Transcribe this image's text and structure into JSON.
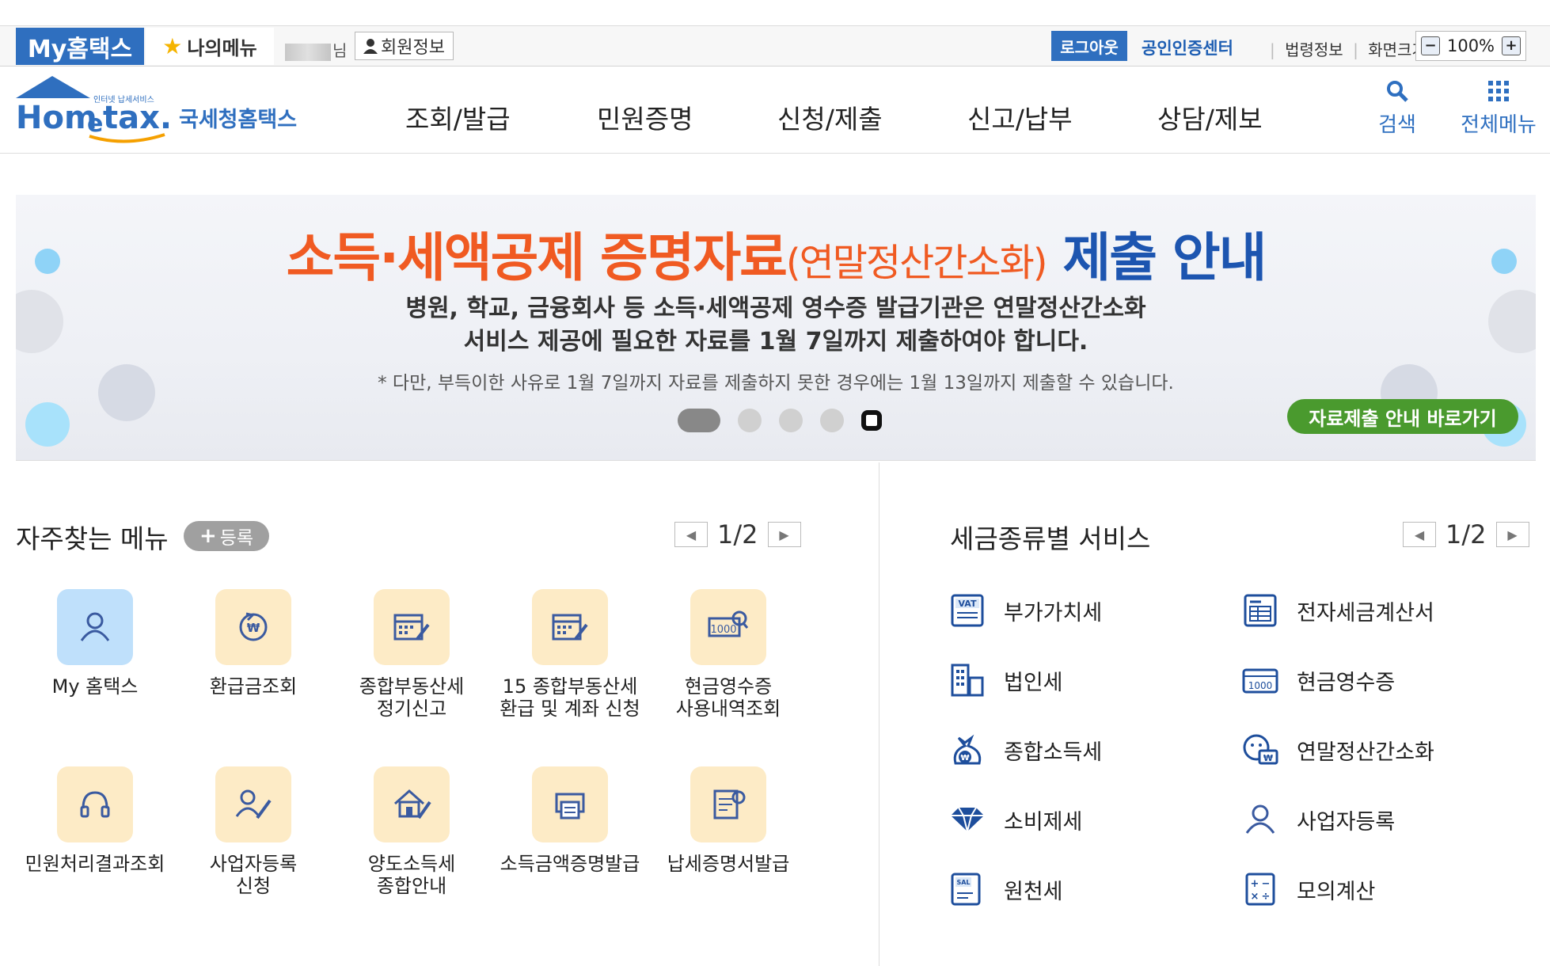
{
  "util": {
    "my_hometax": "My홈택스",
    "my_menu": "나의메뉴",
    "username_suffix": "님",
    "member_info": "회원정보",
    "logout": "로그아웃",
    "cert_center": "공인인증센터",
    "legal_info": "법령정보",
    "screen_size": "화면크기",
    "zoom_level": "100%"
  },
  "header": {
    "logo_small": "인터넷 납세서비스",
    "logo_main": "Hometax",
    "logo_kr": "국세청홈택스",
    "nav": [
      "조회/발급",
      "민원증명",
      "신청/제출",
      "신고/납부",
      "상담/제보"
    ],
    "search_label": "검색",
    "all_menu_label": "전체메뉴"
  },
  "banner": {
    "title_main": "소득·세액공제 증명자료",
    "title_paren": "(연말정산간소화)",
    "title_end": "제출 안내",
    "line1": "병원, 학교, 금융회사 등 소득·세액공제 영수증 발급기관은 연말정산간소화",
    "line2": "서비스 제공에 필요한 자료를 1월 7일까지 제출하여야 합니다.",
    "note": "* 다만, 부득이한 사유로 1월 7일까지 자료를 제출하지 못한 경우에는 1월 13일까지 제출할 수 있습니다.",
    "cta": "자료제출 안내 바로가기",
    "slide_count": 5,
    "active_slide": 1
  },
  "favorites": {
    "title": "자주찾는 메뉴",
    "register": "등록",
    "page": "1/2",
    "items": [
      {
        "line1": "My 홈택스",
        "line2": "",
        "icon": "person-icon"
      },
      {
        "line1": "환급금조회",
        "line2": "",
        "icon": "refund-icon"
      },
      {
        "line1": "종합부동산세",
        "line2": "정기신고",
        "icon": "calendar-pen-icon"
      },
      {
        "line1": "15 종합부동산세",
        "line2": "환급 및 계좌 신청",
        "icon": "calendar-pen-icon"
      },
      {
        "line1": "현금영수증",
        "line2": "사용내역조회",
        "icon": "receipt-search-icon"
      },
      {
        "line1": "민원처리결과조회",
        "line2": "",
        "icon": "headset-icon"
      },
      {
        "line1": "사업자등록",
        "line2": "신청",
        "icon": "person-pen-icon"
      },
      {
        "line1": "양도소득세",
        "line2": "종합안내",
        "icon": "house-pen-icon"
      },
      {
        "line1": "소득금액증명발급",
        "line2": "",
        "icon": "printer-icon"
      },
      {
        "line1": "납세증명서발급",
        "line2": "",
        "icon": "certificate-icon"
      }
    ]
  },
  "tax_services": {
    "title": "세금종류별 서비스",
    "page": "1/2",
    "items": [
      {
        "label": "부가가치세",
        "icon": "vat-icon"
      },
      {
        "label": "전자세금계산서",
        "icon": "invoice-icon"
      },
      {
        "label": "법인세",
        "icon": "building-icon"
      },
      {
        "label": "현금영수증",
        "icon": "cash-receipt-icon"
      },
      {
        "label": "종합소득세",
        "icon": "money-bag-icon"
      },
      {
        "label": "연말정산간소화",
        "icon": "year-end-icon"
      },
      {
        "label": "소비제세",
        "icon": "diamond-icon"
      },
      {
        "label": "사업자등록",
        "icon": "person-icon"
      },
      {
        "label": "원천세",
        "icon": "salary-icon"
      },
      {
        "label": "모의계산",
        "icon": "calculator-icon"
      }
    ]
  },
  "colors": {
    "primary_blue": "#2f6fbf",
    "banner_orange": "#f05a22",
    "banner_blue": "#1d55b0",
    "cta_green": "#4a9a2e",
    "icon_tile": "#fdebc6"
  }
}
